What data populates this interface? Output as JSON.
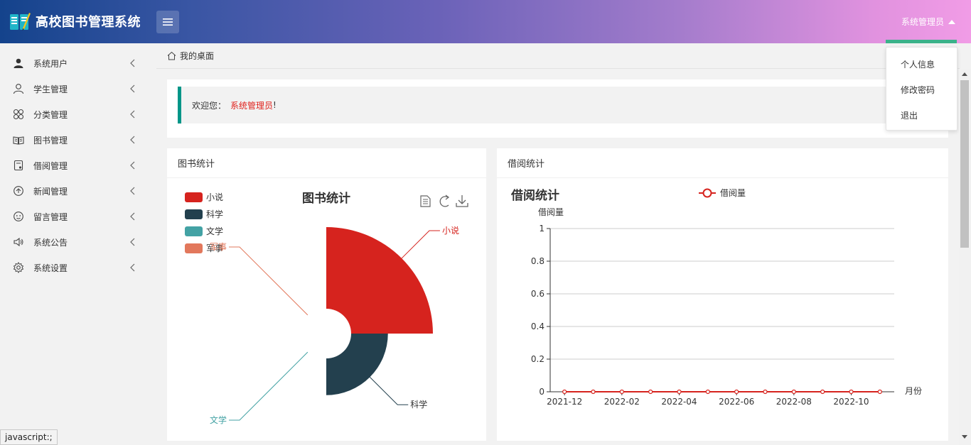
{
  "app": {
    "title": "高校图书管理系统",
    "user": "系统管理员",
    "accent": "#009688"
  },
  "sidebar": {
    "items": [
      {
        "label": "系统用户",
        "icon": "user-icon"
      },
      {
        "label": "学生管理",
        "icon": "person-outline-icon"
      },
      {
        "label": "分类管理",
        "icon": "category-icon"
      },
      {
        "label": "图书管理",
        "icon": "book-icon"
      },
      {
        "label": "借阅管理",
        "icon": "borrow-icon"
      },
      {
        "label": "新闻管理",
        "icon": "news-icon"
      },
      {
        "label": "留言管理",
        "icon": "message-icon"
      },
      {
        "label": "系统公告",
        "icon": "speaker-icon"
      },
      {
        "label": "系统设置",
        "icon": "gear-icon"
      }
    ]
  },
  "breadcrumb": {
    "home": "我的桌面"
  },
  "welcome": {
    "prefix": "欢迎您：",
    "name": "系统管理员",
    "suffix": "!"
  },
  "dropdown": {
    "items": [
      "个人信息",
      "修改密码",
      "退出"
    ]
  },
  "status_bar": "javascript:;",
  "panels": {
    "books": {
      "header": "图书统计"
    },
    "borrow": {
      "header": "借阅统计"
    }
  },
  "chart_data": [
    {
      "type": "pie",
      "title": "图书统计",
      "subtype": "rose",
      "legend": [
        "小说",
        "科学",
        "文学",
        "军事"
      ],
      "legend_position": "top-left",
      "categories": [
        "小说",
        "科学",
        "文学",
        "军事"
      ],
      "values": [
        100,
        45,
        0,
        0
      ],
      "colors": [
        "#d6231e",
        "#23404e",
        "#43a2a4",
        "#e2785c"
      ],
      "toolbox": [
        "data-view-icon",
        "refresh-icon",
        "download-icon"
      ]
    },
    {
      "type": "line",
      "title": "借阅统计",
      "ylabel": "借阅量",
      "xlabel": "月份",
      "legend": [
        "借阅量"
      ],
      "legend_position": "top-center",
      "x": [
        "2021-12",
        "2022-01",
        "2022-02",
        "2022-03",
        "2022-04",
        "2022-05",
        "2022-06",
        "2022-07",
        "2022-08",
        "2022-09",
        "2022-10",
        "2022-11"
      ],
      "x_tick_labels": [
        "2021-12",
        "2022-02",
        "2022-04",
        "2022-06",
        "2022-08",
        "2022-10"
      ],
      "series": [
        {
          "name": "借阅量",
          "values": [
            0,
            0,
            0,
            0,
            0,
            0,
            0,
            0,
            0,
            0,
            0,
            0
          ],
          "color": "#d6231e"
        }
      ],
      "ylim": [
        0,
        1
      ],
      "y_ticks": [
        "0",
        "0.2",
        "0.4",
        "0.6",
        "0.8",
        "1"
      ],
      "grid": true
    }
  ]
}
